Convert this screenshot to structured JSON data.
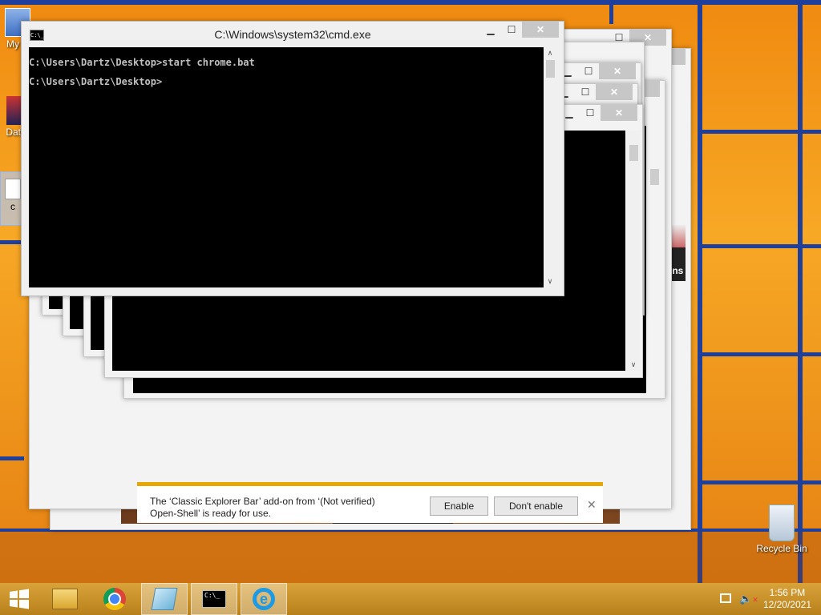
{
  "desktop": {
    "icons": [
      {
        "label": "My C",
        "icon": "computer-icon"
      },
      {
        "label": "Data",
        "icon": "shortcut-icon"
      },
      {
        "label": "c",
        "icon": "file-icon"
      },
      {
        "label": "Recycle Bin",
        "icon": "recycle-bin-icon"
      }
    ]
  },
  "cmd_window": {
    "title": "C:\\Windows\\system32\\cmd.exe",
    "lines": [
      "C:\\Users\\Dartz\\Desktop>start chrome.bat",
      "C:\\Users\\Dartz\\Desktop>"
    ],
    "controls": {
      "minimize": "▁",
      "maximize": "☐",
      "close": "✕"
    }
  },
  "background_windows": {
    "clipped_text": "ons",
    "browser_icons": [
      "home-icon",
      "star-icon",
      "gear-icon"
    ]
  },
  "ie_notification": {
    "message_line1": "The ‘Classic Explorer Bar’ add-on from ‘(Not verified)",
    "message_line2": "Open-Shell’ is ready for use.",
    "enable_label": "Enable",
    "dont_enable_label": "Don't enable",
    "close_glyph": "✕"
  },
  "taskbar": {
    "items": [
      "start-icon",
      "file-explorer-icon",
      "chrome-icon",
      "app-icon",
      "cmd-icon",
      "internet-explorer-icon"
    ],
    "clock_time": "1:56 PM",
    "clock_date": "12/20/2021"
  },
  "colors": {
    "accent_bar": "#e6a800",
    "wallpaper": "#f39a1a",
    "taskbar": "#c8901f"
  }
}
